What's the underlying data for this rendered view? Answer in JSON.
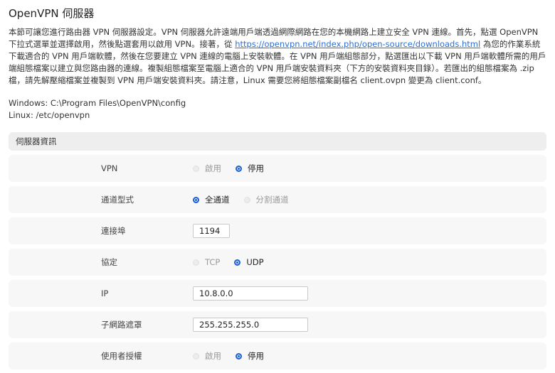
{
  "page": {
    "title": "OpenVPN 伺服器",
    "desc_before_link": "本節可讓您進行路由器 VPN 伺服器設定。VPN 伺服器允許遠端用戶端透過網際網路在您的本機網路上建立安全 VPN 連線。首先，點選 OpenVPN 下拉式選單並選擇啟用，然後點選套用以啟用 VPN。接著，從 ",
    "desc_link": "https://openvpn.net/index.php/open-source/downloads.html",
    "desc_after_link": " 為您的作業系統下載適合的 VPN 用戶端軟體，然後在您要建立 VPN 連線的電腦上安裝軟體。在 VPN 用戶端組態部分，點選匯出以下載 VPN 用戶端軟體所需的用戶端組態檔案以建立與您路由器的連線。複製組態檔案至電腦上適合的 VPN 用戶端安裝資料夾（下方的安裝資料夾目錄）。若匯出的組態檔案為 .zip 檔，請先解壓縮檔案並複製到 VPN 用戶端安裝資料夾。請注意，Linux 需要您將組態檔案副檔名 client.ovpn 變更為 client.conf。",
    "windows_path": "Windows: C:\\Program Files\\OpenVPN\\config",
    "linux_path": "Linux: /etc/openvpn"
  },
  "section": {
    "title": "伺服器資訊",
    "vpn": {
      "label": "VPN",
      "opt1": "啟用",
      "opt2": "停用",
      "selected": "停用"
    },
    "tunnel": {
      "label": "通道型式",
      "opt1": "全通道",
      "opt2": "分割通道",
      "selected": "全通道"
    },
    "port": {
      "label": "連接埠",
      "value": "1194"
    },
    "protocol": {
      "label": "協定",
      "opt1": "TCP",
      "opt2": "UDP",
      "selected": "UDP"
    },
    "ip": {
      "label": "IP",
      "value": "10.8.0.0"
    },
    "mask": {
      "label": "子網路遮罩",
      "value": "255.255.255.0"
    },
    "auth": {
      "label": "使用者授權",
      "opt1": "啟用",
      "opt2": "停用",
      "selected": "停用"
    }
  }
}
